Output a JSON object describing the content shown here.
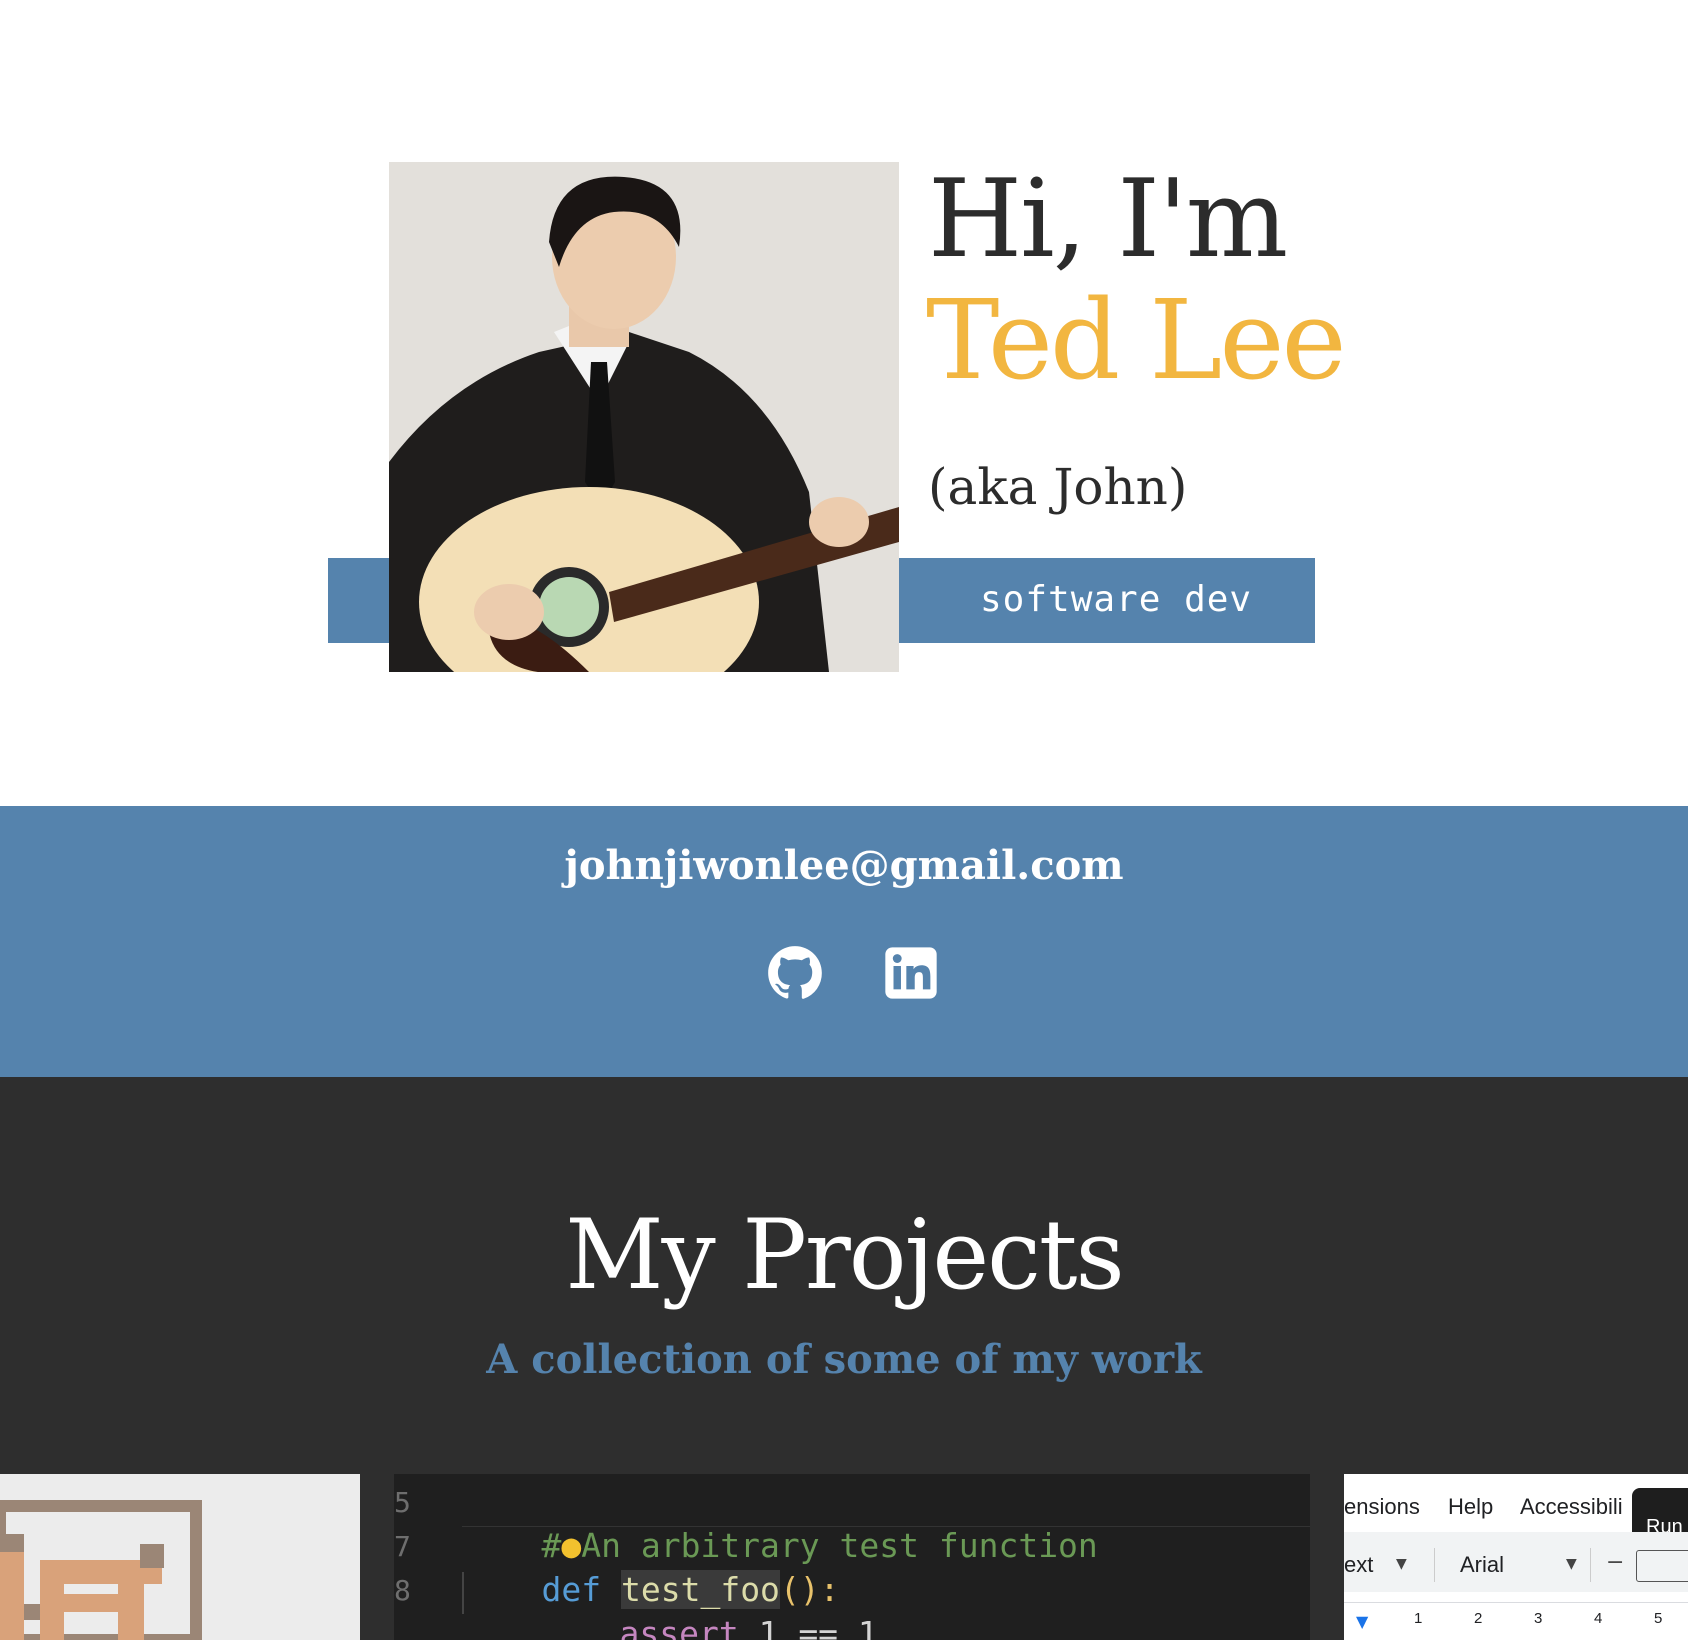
{
  "hero": {
    "greeting": "Hi, I'm",
    "name": "Ted Lee",
    "aka": "(aka John)",
    "role": "software dev",
    "accent_color": "#f2b640",
    "band_color": "#5583ad"
  },
  "contact": {
    "email": "johnjiwonlee@gmail.com",
    "icons": [
      "github-icon",
      "linkedin-icon"
    ]
  },
  "projects": {
    "title": "My Projects",
    "subtitle": "A collection of some of my work",
    "code_card": {
      "line_numbers": [
        "5",
        "7",
        "8"
      ],
      "lines": [
        {
          "comment": "An arbitrary test function"
        },
        {
          "kw": "def",
          "fn_a": "test",
          "fn_b": "_foo",
          "parens": "():"
        },
        {
          "assert_kw": "assert",
          "expr": "1 == 1"
        }
      ]
    },
    "docs_card": {
      "menu": [
        "ensions",
        "Help",
        "Accessibili"
      ],
      "popup": "Run",
      "toolbar_style": "ext",
      "toolbar_font": "Arial",
      "ruler": [
        "1",
        "2",
        "3",
        "4",
        "5"
      ]
    }
  }
}
